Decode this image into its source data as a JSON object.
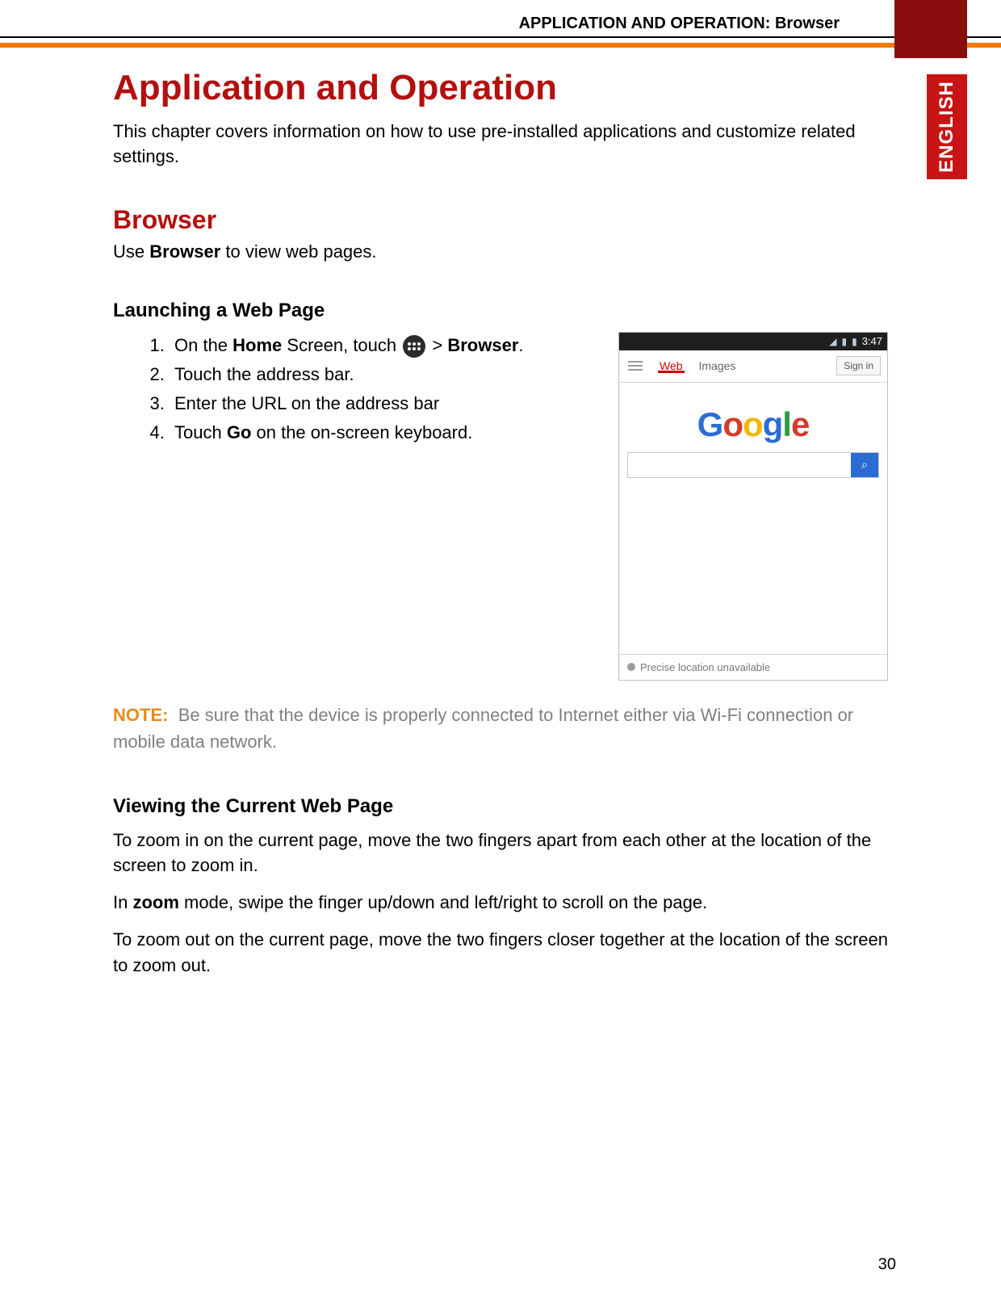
{
  "header": {
    "running_head": "APPLICATION AND OPERATION: Browser",
    "language_tab": "ENGLISH"
  },
  "h1": "Application and Operation",
  "intro": "This chapter covers information on how to use pre-installed applications and customize related settings.",
  "h2": "Browser",
  "use_line_pre": "Use ",
  "use_line_bold": "Browser",
  "use_line_post": " to view web pages.",
  "section_launch": {
    "title": "Launching a Web Page",
    "steps": {
      "s1_pre": "On the ",
      "s1_bold1": "Home",
      "s1_mid": " Screen, touch ",
      "s1_gt": "  > ",
      "s1_bold2": "Browser",
      "s1_post": ".",
      "s2": "Touch the address bar.",
      "s3": "Enter the URL on the address bar",
      "s4_pre": "Touch ",
      "s4_bold": "Go",
      "s4_post": " on the on-screen keyboard."
    }
  },
  "phone": {
    "time": "3:47",
    "tab_web": "Web",
    "tab_images": "Images",
    "sign_in": "Sign in",
    "logo": {
      "l1": "G",
      "l2": "o",
      "l3": "o",
      "l4": "g",
      "l5": "l",
      "l6": "e"
    },
    "search_placeholder": "",
    "location": "Precise location unavailable"
  },
  "note": {
    "label": "NOTE:",
    "text": "Be sure that the device is properly connected to Internet either via Wi-Fi connection or mobile data network."
  },
  "section_view": {
    "title": "Viewing the Current Web Page",
    "p1": "To zoom in on the current page, move the two fingers apart from each other at the location of the screen to zoom in.",
    "p2_pre": "In ",
    "p2_bold": "zoom",
    "p2_post": " mode, swipe the finger up/down and left/right to scroll on the page.",
    "p3": "To zoom out on the current page, move the two fingers closer together at the location of the screen to zoom out."
  },
  "page_number": "30"
}
